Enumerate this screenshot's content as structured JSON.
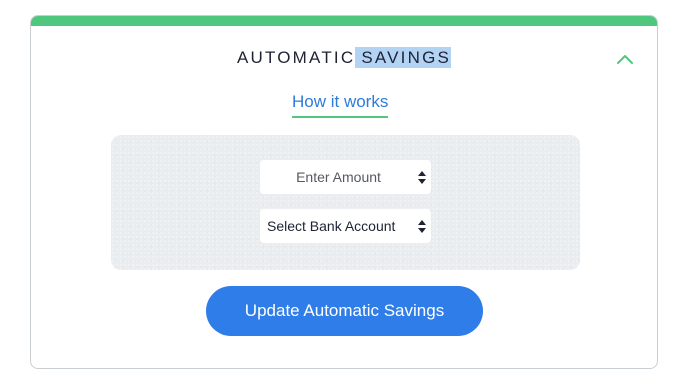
{
  "card": {
    "title_part1": "AUTOMATIC",
    "title_part2": "SAVINGS",
    "accent_color": "#4fc77e",
    "collapse_icon": "chevron-up-icon"
  },
  "how_it_works": {
    "label": "How it works",
    "color": "#2f7bd9"
  },
  "form": {
    "amount_select": {
      "selected": "Enter Amount"
    },
    "bank_select": {
      "selected": "Select Bank Account"
    }
  },
  "submit_button": {
    "label": "Update Automatic Savings",
    "color": "#2f7de8"
  }
}
